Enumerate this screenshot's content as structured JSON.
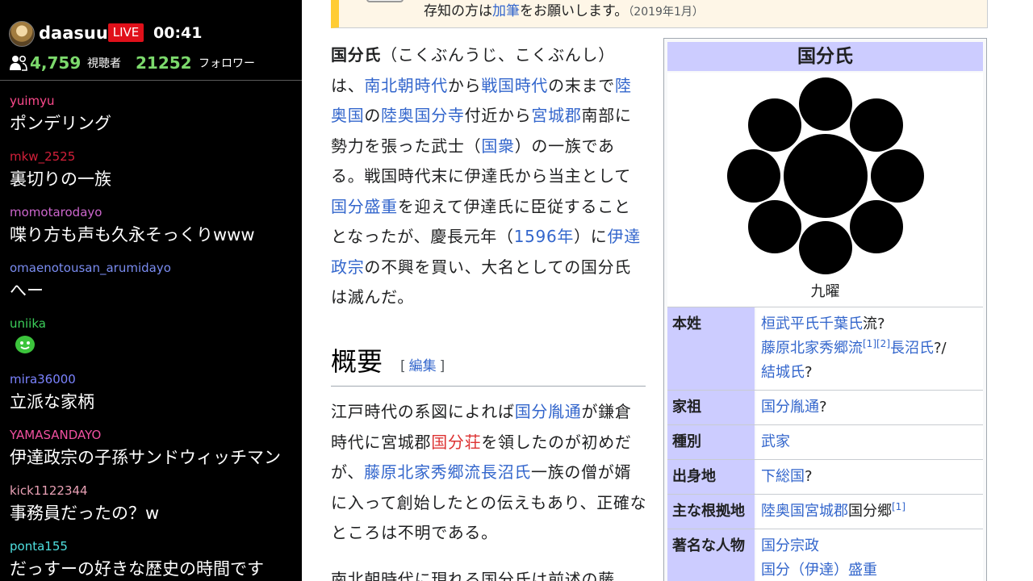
{
  "stream": {
    "streamer": "daasuu",
    "live_label": "LIVE",
    "timer": "00:41",
    "viewer_count": "4,759",
    "viewer_label": "視聴者",
    "follower_count": "21252",
    "follower_label": "フォロワー"
  },
  "chat": [
    {
      "user": "yuimyu",
      "color": "#ff4a8d",
      "text": "ポンデリング"
    },
    {
      "user": "mkw_2525",
      "color": "#d2203a",
      "text": "裏切りの一族"
    },
    {
      "user": "momotarodayo",
      "color": "#cc66cc",
      "text": "喋り方も声も久永そっくりwww"
    },
    {
      "user": "omaenotousan_arumidayo",
      "color": "#7a8cf0",
      "text": "へー"
    },
    {
      "user": "uniika",
      "color": "#3ccf5a",
      "text": "",
      "emote": "green-emote-icon"
    },
    {
      "user": "mira36000",
      "color": "#7b83ff",
      "text": "立派な家柄"
    },
    {
      "user": "YAMASANDAYO",
      "color": "#f050a0",
      "text": "伊達政宗の子孫サンドウィッチマン"
    },
    {
      "user": "kick1122344",
      "color": "#e8a0b4",
      "text": "事務員だったの？w"
    },
    {
      "user": "ponta155",
      "color": "#4fe0e0",
      "text": "だっすーの好きな歴史の時間です"
    }
  ],
  "notice": {
    "text_before": "存知の方は",
    "link": "加筆",
    "text_after": "をお願いします。",
    "date": "（2019年1月）"
  },
  "article": {
    "lead": {
      "bold": "国分氏",
      "t1": "（こくぶんうじ、こくぶんし）は、",
      "l1": "南北朝時代",
      "t2": "から",
      "l2": "戦国時代",
      "t3": "の末まで",
      "l3": "陸奥国",
      "t4": "の",
      "l4": "陸奥国分寺",
      "t5": "付近から",
      "l5": "宮城郡",
      "t6": "南部に勢力を張った武士（",
      "l6": "国衆",
      "t7": "）の一族である。戦国時代末に伊達氏から当主として",
      "l7": "国分盛重",
      "t8": "を迎えて伊達氏に臣従することとなったが、慶長元年（",
      "l8": "1596年",
      "t9": "）に",
      "l9": "伊達政宗",
      "t10": "の不興を買い、大名としての国分氏は滅んだ。"
    },
    "section_title": "概要",
    "edit_open": "[",
    "edit_label": "編集",
    "edit_close": "]",
    "overview": {
      "t1": "江戸時代の系図によれば",
      "l1": "国分胤通",
      "t2": "が鎌倉時代に宮城郡",
      "r1": "国分荘",
      "t3": "を領したのが初めだが、",
      "l2": "藤原北家秀郷流長沼氏",
      "t4": "一族の僧が婿に入って創始したとの伝えもあり、正確なところは不明である。"
    },
    "next_line": "南北朝時代に現れる国分氏は前述の藤"
  },
  "infobox": {
    "title": "国分氏",
    "caption": "九曜",
    "rows": [
      {
        "label": "本姓",
        "parts": [
          {
            "type": "link",
            "text": "桓武平氏千葉氏"
          },
          {
            "type": "text",
            "text": "流?"
          },
          {
            "type": "br"
          },
          {
            "type": "link",
            "text": "藤原北家秀郷流"
          },
          {
            "type": "sup",
            "text": "[1][2]"
          },
          {
            "type": "link",
            "text": "長沼氏"
          },
          {
            "type": "text",
            "text": "?/"
          },
          {
            "type": "br"
          },
          {
            "type": "link",
            "text": "結城氏"
          },
          {
            "type": "text",
            "text": "?"
          }
        ]
      },
      {
        "label": "家祖",
        "parts": [
          {
            "type": "link",
            "text": "国分胤通"
          },
          {
            "type": "text",
            "text": "?"
          }
        ]
      },
      {
        "label": "種別",
        "parts": [
          {
            "type": "link",
            "text": "武家"
          }
        ]
      },
      {
        "label": "出身地",
        "parts": [
          {
            "type": "link",
            "text": "下総国"
          },
          {
            "type": "text",
            "text": "?"
          }
        ]
      },
      {
        "label": "主な根拠地",
        "parts": [
          {
            "type": "link",
            "text": "陸奥国宮城郡"
          },
          {
            "type": "text",
            "text": "国分郷"
          },
          {
            "type": "sup",
            "text": "[1]"
          }
        ]
      },
      {
        "label": "著名な人物",
        "parts": [
          {
            "type": "link",
            "text": "国分宗政"
          },
          {
            "type": "br"
          },
          {
            "type": "link",
            "text": "国分（伊達）盛重"
          }
        ]
      }
    ]
  },
  "colors": {
    "link": "#3366cc",
    "redlink": "#d33",
    "infobox_header": "#ccccff",
    "live_red": "#e0101a",
    "count_green": "#7cd96c"
  }
}
